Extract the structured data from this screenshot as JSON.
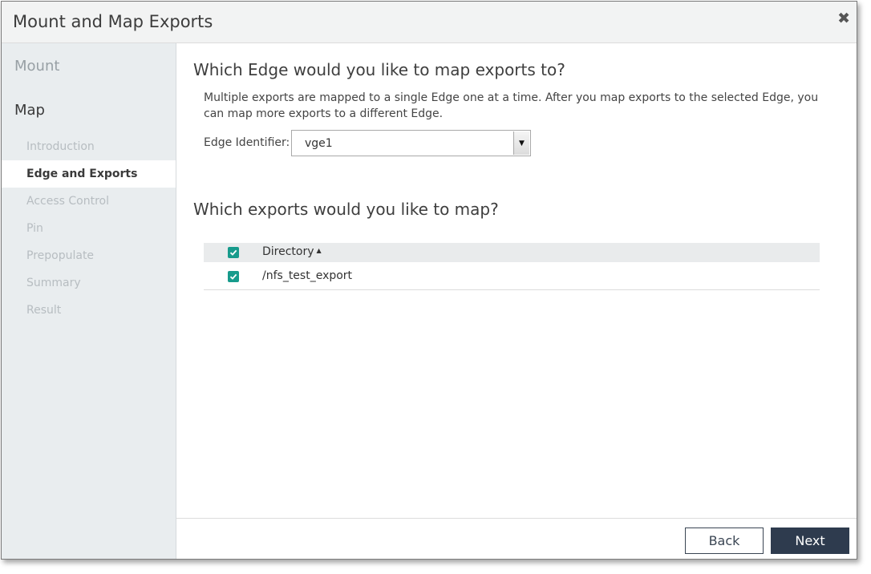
{
  "dialog": {
    "title": "Mount and Map Exports",
    "close_icon": "close-icon"
  },
  "sidebar": {
    "mount_label": "Mount",
    "map_label": "Map",
    "steps": [
      {
        "label": "Introduction",
        "active": false
      },
      {
        "label": "Edge and Exports",
        "active": true
      },
      {
        "label": "Access Control",
        "active": false
      },
      {
        "label": "Pin",
        "active": false
      },
      {
        "label": "Prepopulate",
        "active": false
      },
      {
        "label": "Summary",
        "active": false
      },
      {
        "label": "Result",
        "active": false
      }
    ]
  },
  "main": {
    "edge_question": "Which Edge would you like to map exports to?",
    "description": "Multiple exports are mapped to a single Edge one at a time. After you map exports to the selected Edge, you can map more exports to a different Edge.",
    "edge_identifier_label": "Edge Identifier:",
    "edge_identifier_value": "vge1",
    "exports_question": "Which exports would you like to map?",
    "grid": {
      "header": {
        "column": "Directory",
        "sort": "ascending",
        "select_all_checked": true
      },
      "rows": [
        {
          "directory": "/nfs_test_export",
          "checked": true
        }
      ]
    }
  },
  "footer": {
    "back_label": "Back",
    "next_label": "Next"
  },
  "colors": {
    "checkbox": "#179b8c",
    "primary_button": "#2e3b4e",
    "sidebar_bg": "#e9edef"
  }
}
